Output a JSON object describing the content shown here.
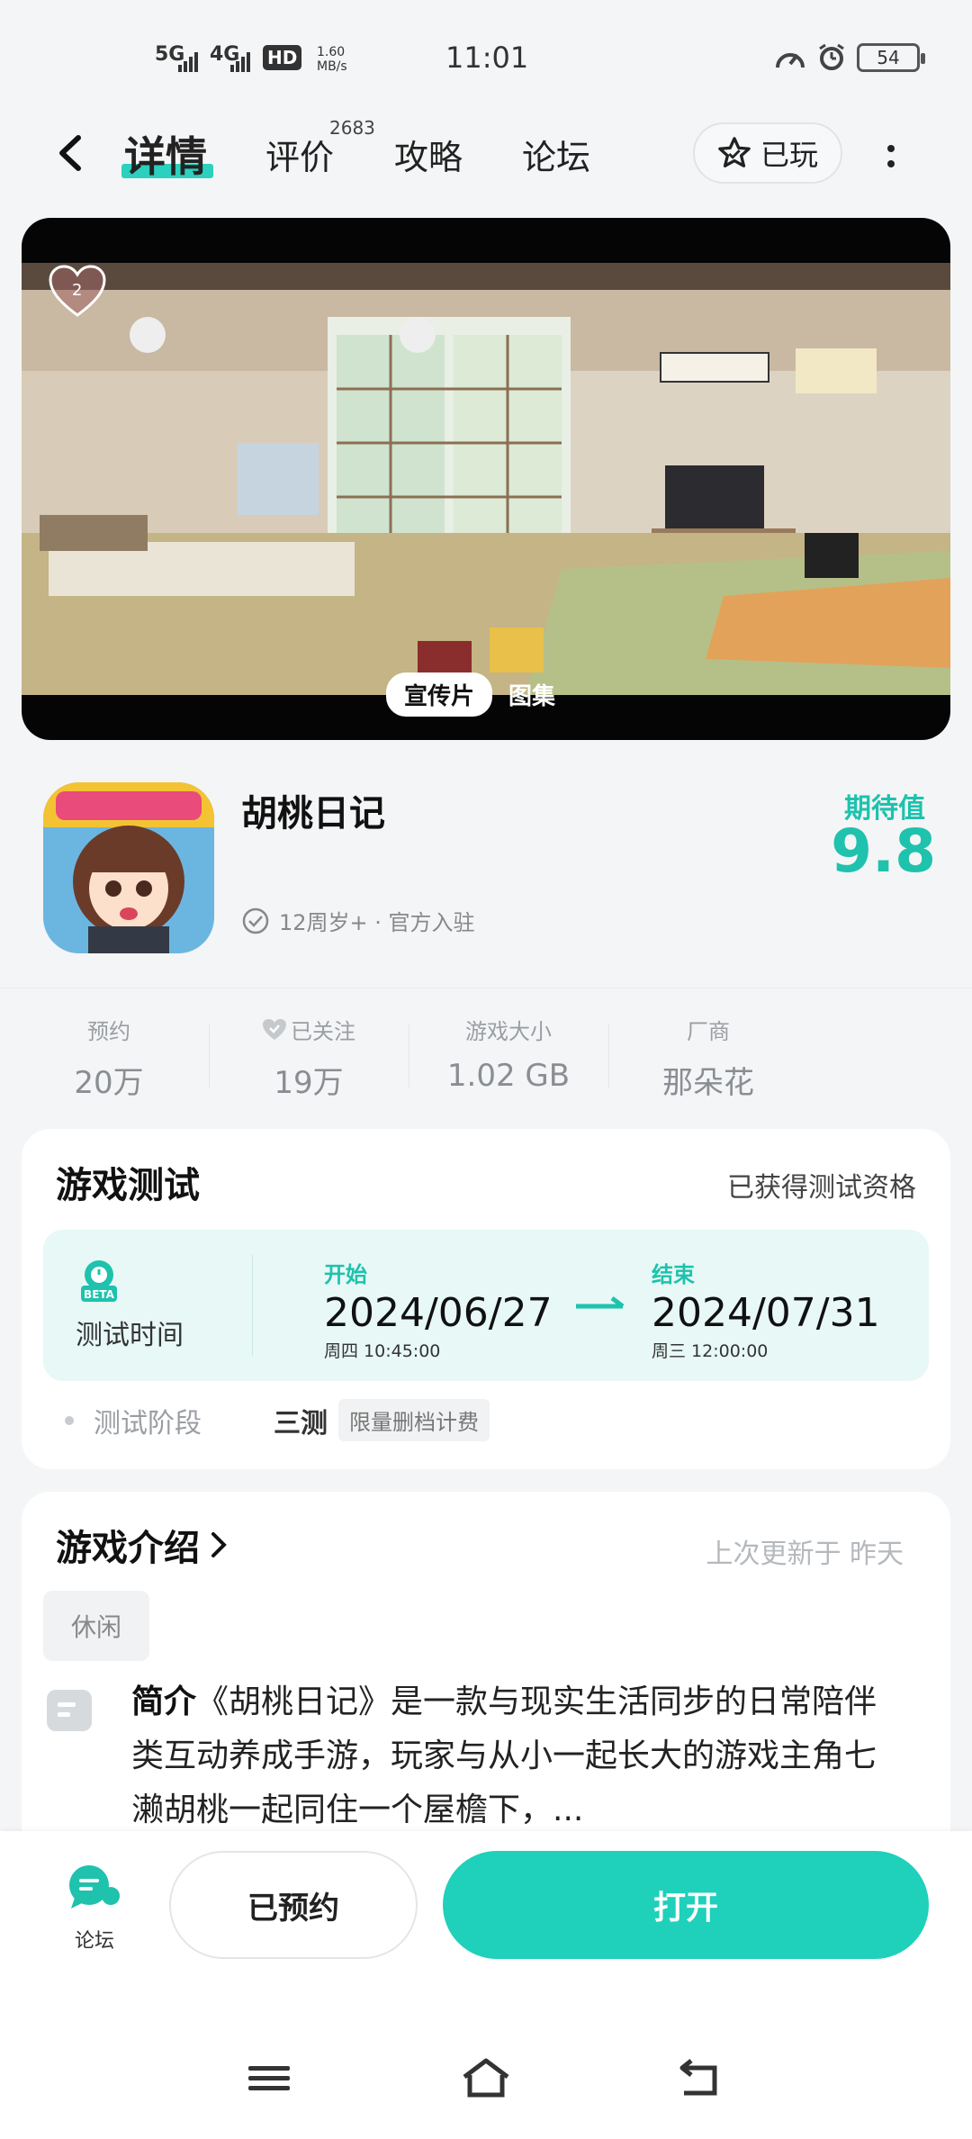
{
  "status_bar": {
    "net1": "5G",
    "net2": "4G",
    "hd": "HD",
    "speed": "1.60 MB/s",
    "time": "11:01",
    "battery": "54"
  },
  "topnav": {
    "tabs": [
      {
        "label": "详情",
        "active": true
      },
      {
        "label": "评价",
        "badge": "2683"
      },
      {
        "label": "攻略"
      },
      {
        "label": "论坛"
      }
    ],
    "played_label": "已玩"
  },
  "hero": {
    "like_count": "2",
    "tabs": [
      "宣传片",
      "图集"
    ]
  },
  "game": {
    "title": "胡桃日记",
    "meta": "12周岁+ · 官方入驻",
    "expect_label": "期待值",
    "expect_value": "9.8"
  },
  "stats": [
    {
      "label": "预约",
      "value": "20万"
    },
    {
      "label": "已关注",
      "value": "19万"
    },
    {
      "label": "游戏大小",
      "value": "1.02 GB"
    },
    {
      "label": "厂商",
      "value": "那朵花"
    }
  ],
  "test": {
    "title": "游戏测试",
    "status": "已获得测试资格",
    "time_label": "测试时间",
    "start": {
      "head": "开始",
      "date": "2024/06/27",
      "sub": "周四 10:45:00"
    },
    "end": {
      "head": "结束",
      "date": "2024/07/31",
      "sub": "周三 12:00:00"
    },
    "stage_label": "测试阶段",
    "stage_value": "三测",
    "stage_tag": "限量删档计费"
  },
  "intro": {
    "title": "游戏介绍",
    "updated": "上次更新于 昨天",
    "tag": "休闲",
    "text_bold": "简介",
    "text": "《胡桃日记》是一款与现实生活同步的日常陪伴类互动养成手游，玩家与从小一起长大的游戏主角七濑胡桃一起同住一个屋檐下，..."
  },
  "bottom": {
    "forum_label": "论坛",
    "reserved_label": "已预约",
    "open_label": "打开"
  },
  "colors": {
    "accent": "#1fd0bb",
    "accent_dark": "#1ec2ad"
  }
}
